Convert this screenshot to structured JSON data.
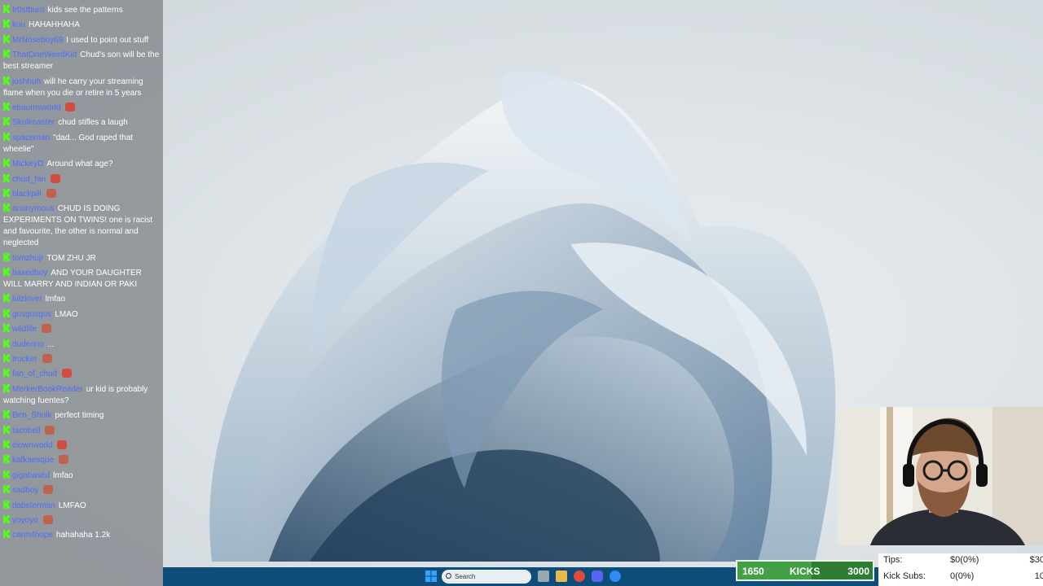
{
  "chat": {
    "messages": [
      {
        "user": "fr0stburn",
        "text": "kids see the patterns"
      },
      {
        "user": "kuu",
        "text": "HAHAHHAHA"
      },
      {
        "user": "MrNoseboy69",
        "text": "I used to point out stuff"
      },
      {
        "user": "ThatOneWeirdKid",
        "text": "Chud's son will be the best streamer"
      },
      {
        "user": "joshhuh",
        "text": "will he carry your streaming flame when you die or retire in 5 years"
      },
      {
        "user": "ebaumsworld",
        "text": ""
      },
      {
        "user": "Skullmaster",
        "text": "chud stifles a laugh"
      },
      {
        "user": "spaceman",
        "text": "\"dad... God raped that wheelie\""
      },
      {
        "user": "MickeyD",
        "text": "Around what age?"
      },
      {
        "user": "chud_fan",
        "text": ""
      },
      {
        "user": "blackpill",
        "text": ""
      },
      {
        "user": "anonymous",
        "text": "CHUD IS DOING EXPERIMENTS ON TWINS! one is racist and favourite, the other is normal and neglected"
      },
      {
        "user": "tomzhujr",
        "text": "TOM ZHU JR"
      },
      {
        "user": "basedboy",
        "text": "AND YOUR DAUGHTER WILL MARRY AND INDIAN OR PAKI"
      },
      {
        "user": "lulzlover",
        "text": "lmfao"
      },
      {
        "user": "gusgusgus",
        "text": "LMAO"
      },
      {
        "user": "wildlife",
        "text": ""
      },
      {
        "user": "duderino",
        "text": "..."
      },
      {
        "user": "trucker",
        "text": ""
      },
      {
        "user": "fan_of_chud",
        "text": ""
      },
      {
        "user": "MerkerBookReader",
        "text": "ur kid is probably watching fuentes?"
      },
      {
        "user": "Ben_Shulk",
        "text": "perfect timing"
      },
      {
        "user": "tacobell",
        "text": ""
      },
      {
        "user": "clownworld",
        "text": ""
      },
      {
        "user": "kafkaesque",
        "text": ""
      },
      {
        "user": "gigabased",
        "text": "lmfao"
      },
      {
        "user": "sadboy",
        "text": ""
      },
      {
        "user": "dabsterman",
        "text": "LMFAO"
      },
      {
        "user": "yoyoyo",
        "text": ""
      },
      {
        "user": "carm4hope",
        "text": "hahahaha 1.2k"
      }
    ]
  },
  "taskbar": {
    "search_label": "Search"
  },
  "kicks": {
    "current": "1650",
    "label": "KICKS",
    "goal": "3000",
    "progress": 0.55
  },
  "tips": {
    "tips_label": "Tips:",
    "tips_value": "$0(0%)",
    "tips_goal": "$30",
    "subs_label": "Kick Subs:",
    "subs_value": "0(0%)",
    "subs_goal": "10"
  },
  "colors": {
    "accent_user": "#4d6cff",
    "kick_green": "#53fc18",
    "taskbar": "#0e4c7a"
  }
}
